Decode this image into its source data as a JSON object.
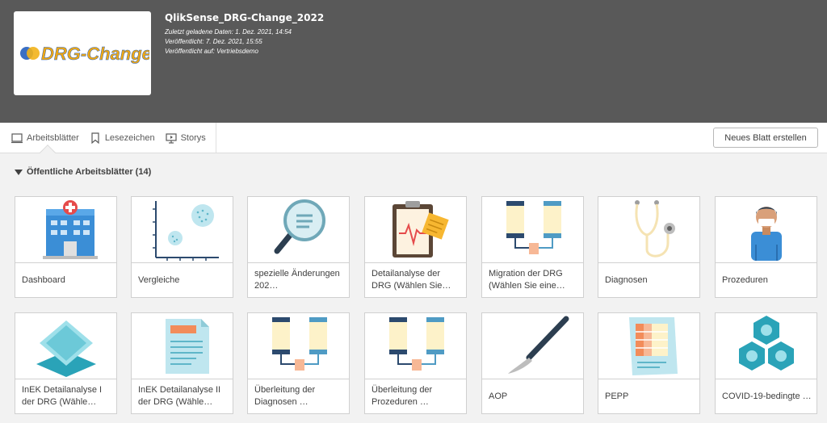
{
  "app": {
    "title": "QlikSense_DRG-Change_2022",
    "meta": [
      "Zuletzt geladene Daten: 1. Dez. 2021, 14:54",
      "Veröffentlicht: 7. Dez. 2021, 15:55",
      "Veröffentlicht auf: Vertriebsdemo"
    ],
    "logo_text": "DRG-Change"
  },
  "tabs": [
    {
      "label": "Arbeitsblätter",
      "icon": "sheet-icon"
    },
    {
      "label": "Lesezeichen",
      "icon": "bookmark-icon"
    },
    {
      "label": "Storys",
      "icon": "story-icon"
    }
  ],
  "new_sheet_button": "Neues Blatt erstellen",
  "section": {
    "title": "Öffentliche Arbeitsblätter (14)"
  },
  "sheets": [
    {
      "title": "Dashboard",
      "icon": "hospital-icon"
    },
    {
      "title": "Vergleiche",
      "icon": "scatter-chart-icon"
    },
    {
      "title": "spezielle Änderungen 202…",
      "icon": "magnifier-icon"
    },
    {
      "title": "Detailanalyse der DRG (Wählen Sie…",
      "icon": "clipboard-ecg-icon"
    },
    {
      "title": "Migration der DRG (Wählen Sie eine…",
      "icon": "flow-migration-icon"
    },
    {
      "title": "Diagnosen",
      "icon": "stethoscope-icon"
    },
    {
      "title": "Prozeduren",
      "icon": "doctor-icon"
    },
    {
      "title": "InEK Detailanalyse I der DRG (Wähle…",
      "icon": "layers-icon"
    },
    {
      "title": "InEK Detailanalyse II der DRG (Wähle…",
      "icon": "document-icon"
    },
    {
      "title": "Überleitung der Diagnosen …",
      "icon": "flow-icon"
    },
    {
      "title": "Überleitung der Prozeduren …",
      "icon": "flow-icon"
    },
    {
      "title": "AOP",
      "icon": "scalpel-icon"
    },
    {
      "title": "PEPP",
      "icon": "report-icon"
    },
    {
      "title": "COVID-19-bedingte …",
      "icon": "molecule-icon"
    }
  ]
}
